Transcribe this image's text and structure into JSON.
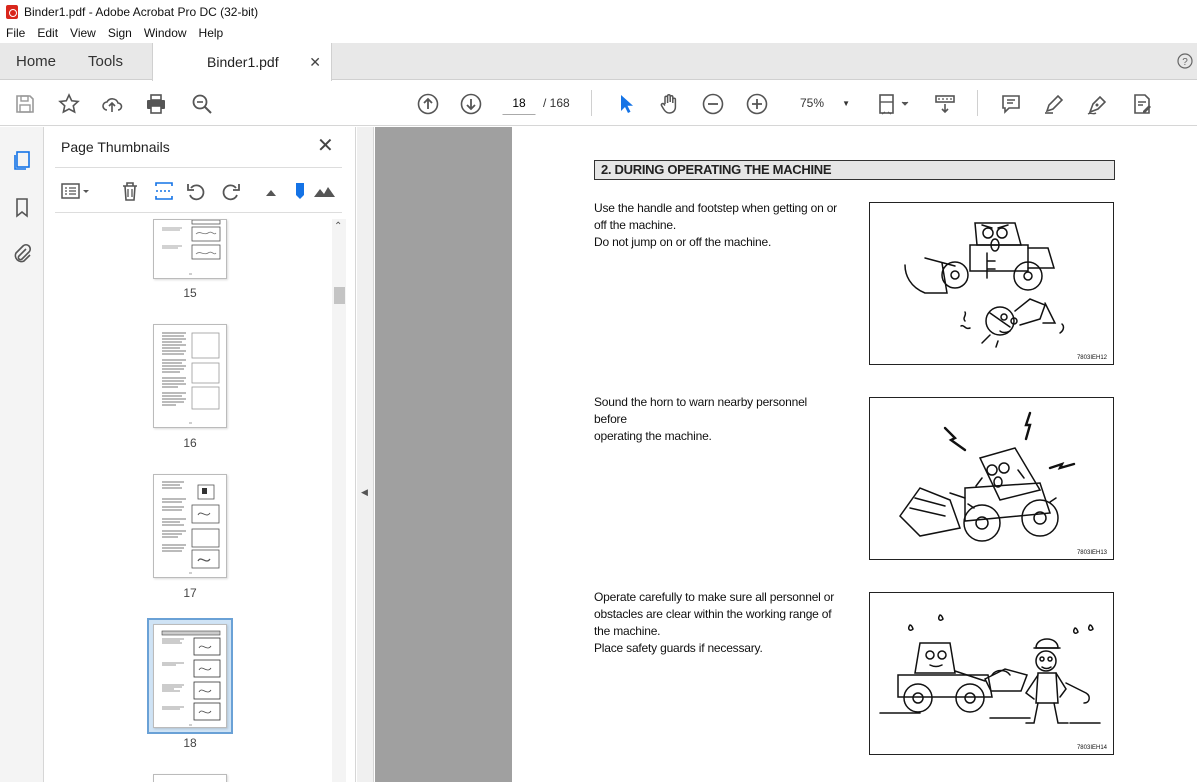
{
  "window": {
    "title": "Binder1.pdf - Adobe Acrobat Pro DC (32-bit)"
  },
  "menu": [
    "File",
    "Edit",
    "View",
    "Sign",
    "Window",
    "Help"
  ],
  "tabs": {
    "home": "Home",
    "tools": "Tools",
    "document": "Binder1.pdf"
  },
  "toolbar": {
    "page_current": "18",
    "page_total": "/ 168",
    "zoom": "75%"
  },
  "panel": {
    "title": "Page Thumbnails",
    "thumbnails": [
      {
        "label": "15"
      },
      {
        "label": "16"
      },
      {
        "label": "17"
      },
      {
        "label": "18",
        "selected": true
      }
    ]
  },
  "document": {
    "heading": "2. DURING OPERATING THE MACHINE",
    "sections": [
      {
        "text_lines": [
          "Use the handle and footstep when getting on or",
          "off the machine.",
          "Do not jump on or off the machine."
        ],
        "figure_code": "7803IEH12"
      },
      {
        "text_lines": [
          "Sound the horn to warn nearby personnel before",
          "operating the machine."
        ],
        "figure_code": "7803IEH13"
      },
      {
        "text_lines": [
          "Operate carefully to make sure all personnel or",
          "obstacles are clear within the working range of",
          "the machine.",
          "Place safety guards if necessary."
        ],
        "figure_code": "7803IEH14"
      }
    ]
  },
  "colors": {
    "accent": "#1473e6",
    "selected_thumb": "#cfe3f5",
    "doc_background": "#a0a0a0"
  }
}
